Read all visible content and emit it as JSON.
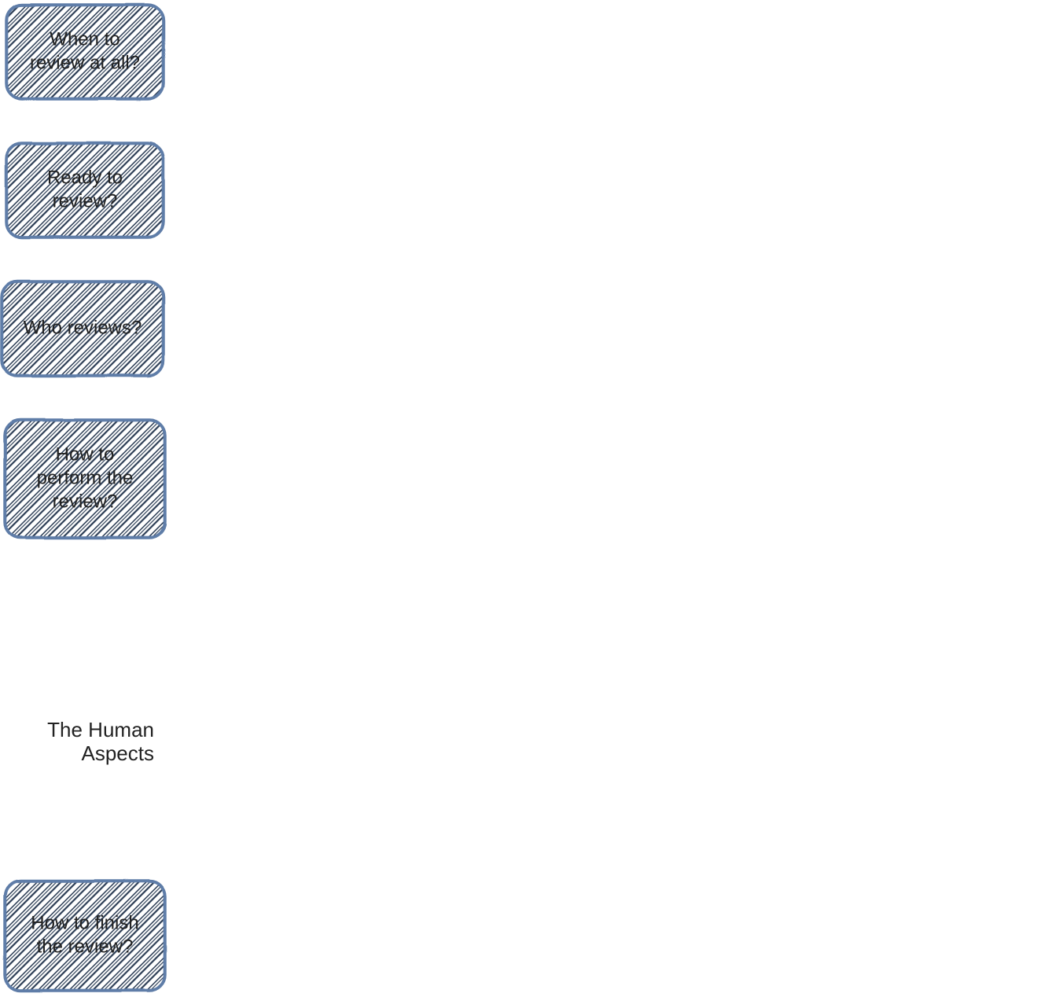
{
  "diagram": {
    "stroke": "#5f7da8",
    "nodes": [
      {
        "id": "n1",
        "label_lines": [
          "When to",
          "review at all?"
        ]
      },
      {
        "id": "n2",
        "label_lines": [
          "Ready to",
          "review?"
        ]
      },
      {
        "id": "n3",
        "label_lines": [
          "Who reviews?"
        ]
      },
      {
        "id": "n4",
        "label_lines": [
          "How to",
          "perform the",
          "review?"
        ]
      },
      {
        "id": "n5",
        "label_lines": [
          "The Human",
          "Aspects"
        ]
      },
      {
        "id": "n6",
        "label_lines": [
          "How to finish",
          "the review?"
        ]
      }
    ],
    "edges": [
      {
        "from": "n1",
        "to": "n2"
      },
      {
        "from": "n2",
        "to": "n3"
      },
      {
        "from": "n3",
        "to": "n4"
      },
      {
        "from": "n4",
        "to": "n5"
      },
      {
        "from": "n5",
        "to": "n6"
      }
    ]
  }
}
